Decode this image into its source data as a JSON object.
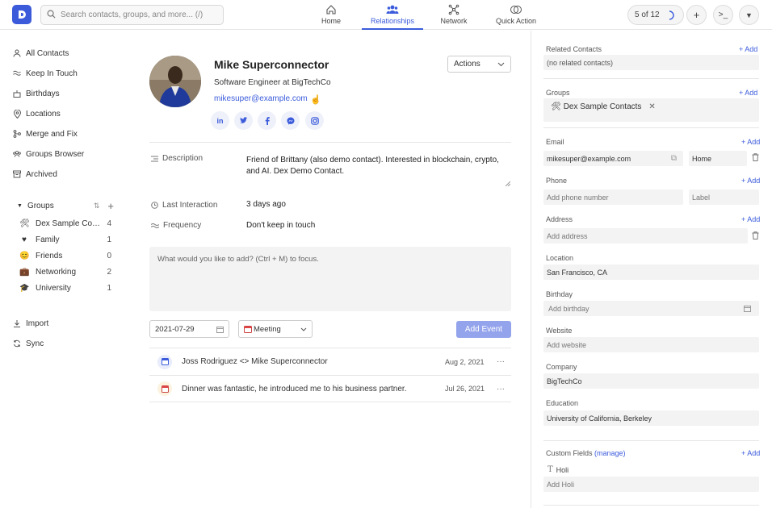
{
  "topbar": {
    "search_placeholder": "Search contacts, groups, and more... (/)",
    "nav": [
      {
        "label": "Home"
      },
      {
        "label": "Relationships"
      },
      {
        "label": "Network"
      },
      {
        "label": "Quick Action"
      }
    ],
    "pager": "5 of 12",
    "accent_color": "#3b5bdb"
  },
  "sidebar": {
    "items": [
      {
        "label": "All Contacts"
      },
      {
        "label": "Keep In Touch"
      },
      {
        "label": "Birthdays"
      },
      {
        "label": "Locations"
      },
      {
        "label": "Merge and Fix"
      },
      {
        "label": "Groups Browser"
      },
      {
        "label": "Archived"
      }
    ],
    "groups_title": "Groups",
    "groups": [
      {
        "emoji": "🛠",
        "label": "Dex Sample Cont...",
        "count": "4"
      },
      {
        "emoji": "♥",
        "label": "Family",
        "count": "1"
      },
      {
        "emoji": "😊",
        "label": "Friends",
        "count": "0"
      },
      {
        "emoji": "💼",
        "label": "Networking",
        "count": "2"
      },
      {
        "emoji": "🎓",
        "label": "University",
        "count": "1"
      }
    ],
    "bottom": [
      {
        "label": "Import"
      },
      {
        "label": "Sync"
      }
    ]
  },
  "contact": {
    "name": "Mike Superconnector",
    "title": "Software Engineer at BigTechCo",
    "email": "mikesuper@example.com",
    "actions_label": "Actions",
    "social": [
      "in",
      "t",
      "f",
      "m",
      "ig"
    ],
    "description_label": "Description",
    "description": "Friend of Brittany (also demo contact).  Interested in blockchain, crypto, and AI. Dex Demo Contact.",
    "last_interaction_label": "Last Interaction",
    "last_interaction": "3 days ago",
    "frequency_label": "Frequency",
    "frequency": "Don't keep in touch"
  },
  "composer": {
    "placeholder": "What would you like to add? (Ctrl + M) to focus.",
    "date": "2021-07-29",
    "type": "Meeting",
    "add_button": "Add Event"
  },
  "events": [
    {
      "text": "Joss Rodriguez <> Mike Superconnector",
      "date": "Aug 2, 2021"
    },
    {
      "text": "Dinner was fantastic, he introduced me to his business partner.",
      "date": "Jul 26, 2021"
    }
  ],
  "right": {
    "related_label": "Related Contacts",
    "related_value": "(no related contacts)",
    "groups_label": "Groups",
    "group_chip": "Dex Sample Contacts",
    "email_label": "Email",
    "email_value": "mikesuper@example.com",
    "email_type": "Home",
    "phone_label": "Phone",
    "phone_placeholder": "Add phone number",
    "phone_label_placeholder": "Label",
    "address_label": "Address",
    "address_placeholder": "Add address",
    "location_label": "Location",
    "location_value": "San Francisco, CA",
    "birthday_label": "Birthday",
    "birthday_placeholder": "Add birthday",
    "website_label": "Website",
    "website_placeholder": "Add website",
    "company_label": "Company",
    "company_value": "BigTechCo",
    "education_label": "Education",
    "education_value": "University of California, Berkeley",
    "custom_label": "Custom Fields",
    "custom_manage": "(manage)",
    "custom_field_name": "Holi",
    "custom_field_placeholder": "Add Holi",
    "add": "+ Add"
  }
}
